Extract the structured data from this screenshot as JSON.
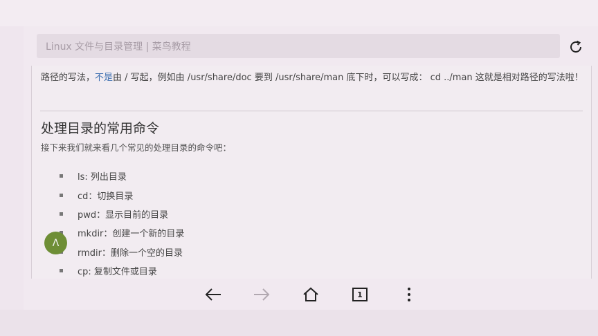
{
  "browser": {
    "url_text": "Linux 文件与目录管理 | 菜鸟教程",
    "nav": {
      "back": "back-arrow-icon",
      "forward": "forward-arrow-icon",
      "home": "home-icon",
      "tab_count": "1",
      "menu": "more-vertical-icon"
    }
  },
  "article": {
    "para_part1": "路径的写法，",
    "para_highlight": "不是",
    "para_part2": "由 / 写起，例如由 /usr/share/doc 要到 /usr/share/man 底下时，可以写成： cd ../man 这就是相对路径的写法啦！",
    "heading": "处理目录的常用命令",
    "intro": "接下来我们就来看几个常见的处理目录的命令吧：",
    "commands": [
      {
        "text": "ls: 列出目录"
      },
      {
        "text": "cd：切换目录"
      },
      {
        "text": "pwd：显示目前的目录"
      },
      {
        "text": "mkdir：创建一个新的目录"
      },
      {
        "text": "rmdir：删除一个空的目录"
      },
      {
        "text": "cp: 复制文件或目录"
      }
    ]
  },
  "back_to_top_label": "Λ",
  "colors": {
    "link": "#3d6fb0",
    "back_to_top": "#6e8e36"
  }
}
